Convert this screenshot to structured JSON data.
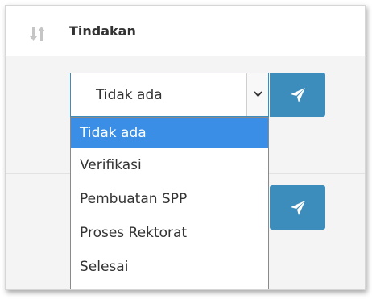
{
  "panel": {
    "title": "Tindakan",
    "sort_icon": "sort-arrows-icon"
  },
  "action_select": {
    "selected_value": "Tidak ada",
    "options": [
      {
        "label": "Tidak ada",
        "selected": true
      },
      {
        "label": "Verifikasi",
        "selected": false
      },
      {
        "label": "Pembuatan SPP",
        "selected": false
      },
      {
        "label": "Proses Rektorat",
        "selected": false
      },
      {
        "label": "Selesai",
        "selected": false
      }
    ]
  },
  "send_button": {
    "icon": "paper-plane-icon"
  },
  "colors": {
    "accent": "#3c8dbc",
    "option_highlight": "#3a8ee6"
  }
}
